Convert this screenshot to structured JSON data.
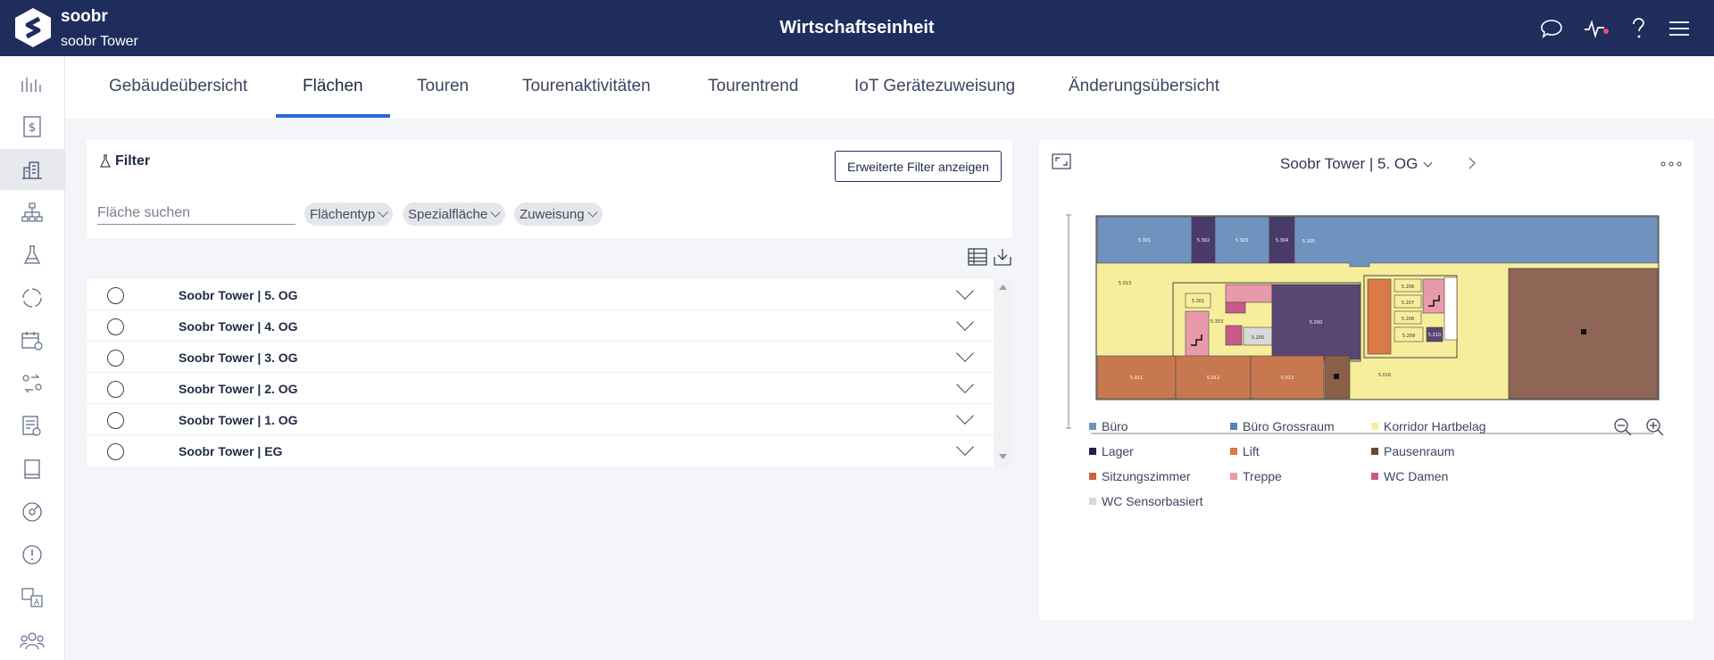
{
  "header": {
    "brand": "soobr",
    "building": "soobr Tower",
    "title": "Wirtschaftseinheit"
  },
  "tabs": [
    {
      "label": "Gebäudeübersicht",
      "active": false
    },
    {
      "label": "Flächen",
      "active": true
    },
    {
      "label": "Touren",
      "active": false
    },
    {
      "label": "Tourenaktivitäten",
      "active": false
    },
    {
      "label": "Tourentrend",
      "active": false
    },
    {
      "label": "IoT Gerätezuweisung",
      "active": false
    },
    {
      "label": "Änderungsübersicht",
      "active": false
    }
  ],
  "filter": {
    "title": "Filter",
    "advanced_button": "Erweiterte Filter anzeigen",
    "search_placeholder": "Fläche suchen",
    "chips": [
      "Flächentyp",
      "Spezialfläche",
      "Zuweisung"
    ]
  },
  "floors": [
    "Soobr Tower | 5. OG",
    "Soobr Tower | 4. OG",
    "Soobr Tower | 3. OG",
    "Soobr Tower | 2. OG",
    "Soobr Tower | 1. OG",
    "Soobr Tower | EG"
  ],
  "plan": {
    "title": "Soobr Tower | 5. OG",
    "rooms": {
      "r5301a": "5.301",
      "r5302": "5.302",
      "r5303": "5.303",
      "r5304": "5.304",
      "r5305": "5.305",
      "r5013": "5.013",
      "r5301b": "5.301",
      "r5303b": "5.303",
      "r5200": "5.200",
      "r5200b": "5.200",
      "r5206": "5.206",
      "r5207": "5.207",
      "r5208": "5.208",
      "r5209": "5.209",
      "r5210": "5.210",
      "r5011": "5.011",
      "r5012": "5.012",
      "r5013b": "5.013",
      "r5016": "5.016"
    },
    "legend": [
      {
        "label": "Büro",
        "color": "#6f93bf"
      },
      {
        "label": "Büro Grossraum",
        "color": "#5b82b8"
      },
      {
        "label": "Korridor Hartbelag",
        "color": "#f7ee9c"
      },
      {
        "label": "Lager",
        "color": "#2b1a4a"
      },
      {
        "label": "Lift",
        "color": "#d97a48"
      },
      {
        "label": "Pausenraum",
        "color": "#6b4636"
      },
      {
        "label": "Sitzungszimmer",
        "color": "#c7643c"
      },
      {
        "label": "Treppe",
        "color": "#e99aaa"
      },
      {
        "label": "WC Damen",
        "color": "#c95a8a"
      },
      {
        "label": "WC Sensorbasiert",
        "color": "#d9d9d9"
      }
    ]
  }
}
